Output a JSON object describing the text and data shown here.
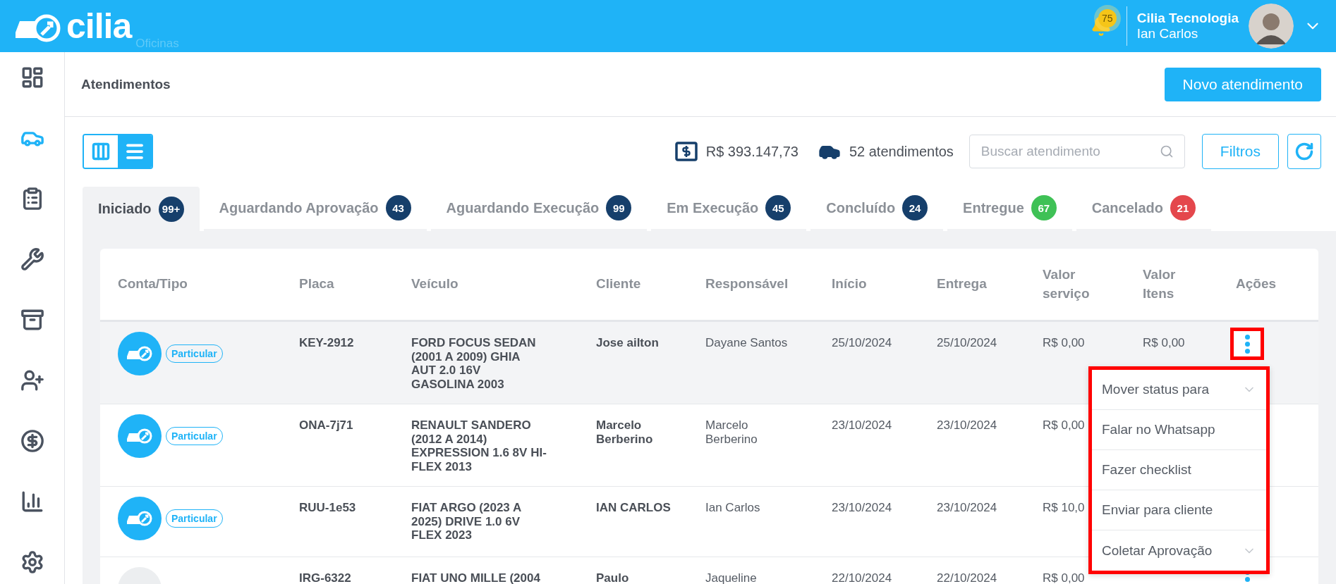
{
  "header": {
    "logo": "cilia",
    "logo_subtitle": "Oficinas",
    "notifications": "75",
    "company": "Cilia Tecnologia",
    "user": "Ian Carlos"
  },
  "sidebar": {
    "items": [
      {
        "kind": "dashboard",
        "selected": false
      },
      {
        "kind": "car",
        "selected": true
      },
      {
        "kind": "clipboard",
        "selected": false
      },
      {
        "kind": "wrench",
        "selected": false
      },
      {
        "kind": "archive",
        "selected": false
      },
      {
        "kind": "user-plus",
        "selected": false
      },
      {
        "kind": "dollar",
        "selected": false
      },
      {
        "kind": "chart",
        "selected": false
      },
      {
        "kind": "settings",
        "selected": false
      }
    ]
  },
  "page": {
    "title": "Atendimentos",
    "new_button": "Novo atendimento"
  },
  "toolbar": {
    "views": [
      {
        "kind": "columns",
        "selected": false
      },
      {
        "kind": "list",
        "selected": true
      }
    ],
    "total": "R$ 393.147,73",
    "count": "52 atendimentos",
    "search": {
      "placeholder": "Buscar atendimento"
    },
    "filters": "Filtros"
  },
  "tabs": [
    {
      "label": "Iniciado",
      "count": "99+",
      "color": "#163f6b",
      "selected": true
    },
    {
      "label": "Aguardando Aprovação",
      "count": "43",
      "color": "#163f6b",
      "selected": false
    },
    {
      "label": "Aguardando Execução",
      "count": "99",
      "color": "#163f6b",
      "selected": false
    },
    {
      "label": "Em Execução",
      "count": "45",
      "color": "#163f6b",
      "selected": false
    },
    {
      "label": "Concluído",
      "count": "24",
      "color": "#163f6b",
      "selected": false
    },
    {
      "label": "Entregue",
      "count": "67",
      "color": "#3fc156",
      "selected": false
    },
    {
      "label": "Cancelado",
      "count": "21",
      "color": "#e4474c",
      "selected": false
    }
  ],
  "table": {
    "columns": [
      "Conta/Tipo",
      "Placa",
      "Veículo",
      "Cliente",
      "Responsável",
      "Início",
      "Entrega",
      "Valor serviço",
      "Valor Itens",
      "Ações"
    ],
    "rows": [
      {
        "kind": "icon",
        "type": "Particular",
        "placa": "KEY-2912",
        "veiculo": "FORD FOCUS SEDAN (2001 A 2009) GHIA AUT 2.0 16V GASOLINA 2003",
        "cliente": "Jose ailton",
        "responsavel": "Dayane Santos",
        "inicio": "25/10/2024",
        "entrega": "25/10/2024",
        "valor_servico": "R$ 0,00",
        "valor_itens": "R$ 0,00",
        "selected": true,
        "kebab": true
      },
      {
        "kind": "icon",
        "type": "Particular",
        "placa": "ONA-7j71",
        "veiculo": "RENAULT SANDERO (2012 A 2014) EXPRESSION 1.6 8V HI-FLEX 2013",
        "cliente": "Marcelo Berberino",
        "responsavel": "Marcelo Berberino",
        "inicio": "23/10/2024",
        "entrega": "23/10/2024",
        "valor_servico": "R$ 0,00",
        "selected": false
      },
      {
        "kind": "icon",
        "type": "Particular",
        "placa": "RUU-1e53",
        "veiculo": "FIAT ARGO (2023 A 2025) DRIVE 1.0 6V FLEX 2023",
        "cliente": "IAN CARLOS",
        "responsavel": "Ian Carlos",
        "inicio": "23/10/2024",
        "entrega": "23/10/2024",
        "valor_servico": "R$ 10,0",
        "selected": false
      },
      {
        "kind": "picture",
        "placa": "IRG-6322",
        "veiculo": "FIAT UNO MILLE (2004",
        "cliente": "Paulo",
        "responsavel": "Jaqueline",
        "inicio": "22/10/2024",
        "entrega": "22/10/2024",
        "valor_servico": "R$ 0,00",
        "selected": false,
        "kebab": true
      }
    ]
  },
  "actions_menu": {
    "items": [
      {
        "label": "Mover status para",
        "has_submenu": true
      },
      {
        "label": "Falar no Whatsapp",
        "has_submenu": false
      },
      {
        "label": "Fazer checklist",
        "has_submenu": false
      },
      {
        "label": "Enviar para cliente",
        "has_submenu": false
      },
      {
        "label": "Coletar Aprovação",
        "has_submenu": true
      }
    ]
  }
}
